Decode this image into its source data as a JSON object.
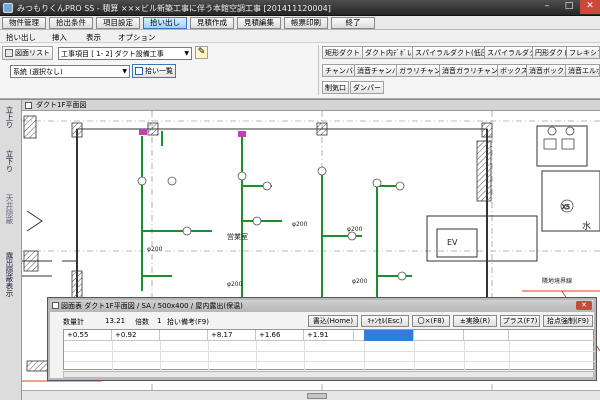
{
  "window": {
    "title": "みつもりくんPRO SS - 積算 ×××ビル新築工事に伴う本館空調工事 [201411120004]",
    "min_label": "–",
    "max_label": "□",
    "close_label": "✕"
  },
  "menubar": [
    "物件管理",
    "拾出条件",
    "項目設定",
    "拾い出し",
    "見積作成",
    "見積編集",
    "帳票印刷",
    "終了"
  ],
  "menubar_active_index": 3,
  "ribbon_tabs": [
    "拾い出し",
    "挿入",
    "表示",
    "オプション"
  ],
  "toolbar": {
    "drawing_list_label": "図面リスト",
    "work_item_combo": "工事項目 [ 1- 2] ダクト設備工事",
    "system_combo": "系統 (選択なし)",
    "pick_list_label": "拾い一覧",
    "duct_buttons_row1": [
      "矩形ダクト",
      "ダクト内ﾃﾞﾎﾞい",
      "スパイラルダクト(低圧)",
      "スパイラルダクト(高圧)",
      "円形ダクト",
      "フレキシブルダクト"
    ],
    "duct_buttons_row2": [
      "チャンバー",
      "消音チャンバー",
      "ガラリチャンバー",
      "消音ガラリチャンバー",
      "ボックス",
      "消音ボックス",
      "消音エルボ"
    ],
    "duct_buttons_row3": [
      "制気口",
      "ダンパー"
    ]
  },
  "left_panel": {
    "tab1": "立上り",
    "tab2": "立下り",
    "tab3": "天井隠蔽",
    "tab4": "露出隠蔽表示"
  },
  "drawing_window": {
    "title": "ダクト1F平面図",
    "labels": {
      "room": "営業室",
      "ev": "EV",
      "x5": "X5",
      "water": "水",
      "dim1": "φ200",
      "dim2": "φ200",
      "dim3": "φ200",
      "dim4": "φ200",
      "dim5": "φ200",
      "adjacent": "隣地境界線"
    }
  },
  "dialog": {
    "title": "図面表 ダクト1F平面図 / SA / 500x400 / 屋内露出(保温)",
    "close_label": "✕",
    "qty_label": "数量計",
    "qty_value": "13.21",
    "factor_label": "倍数",
    "factor_value": "1",
    "note_label": "拾い備考(F9)",
    "buttons": [
      "書込(Home)",
      "ｷｬﾝｾﾙ(Esc)",
      "〇×(F8)",
      "±実換(R)",
      "プラス(F7)",
      "拾点強制(F9)"
    ],
    "row_values": [
      "+0.55",
      "+0.92",
      "+8.17",
      "+1.66",
      "+1.91"
    ]
  },
  "colors": {
    "duct_green": "#1a8f2b",
    "highlight_blue": "#2f7fd9",
    "fitting_magenta": "#c23fb5"
  }
}
